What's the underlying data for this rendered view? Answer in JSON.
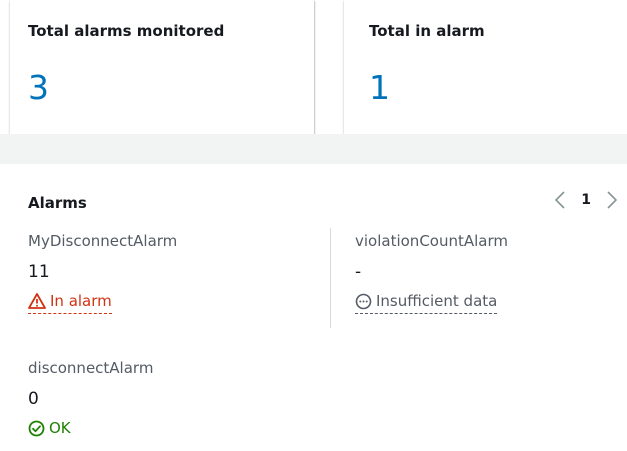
{
  "top_clip": "...",
  "summary": {
    "monitored_label": "Total alarms monitored",
    "monitored_value": "3",
    "inalarm_label": "Total in alarm",
    "inalarm_value": "1"
  },
  "alarms": {
    "title": "Alarms",
    "pagination": {
      "current_page": "1"
    },
    "items": [
      {
        "name": "MyDisconnectAlarm",
        "value": "11",
        "status": "In alarm",
        "status_icon": "warning-icon",
        "status_color": "#d13212"
      },
      {
        "name": "violationCountAlarm",
        "value": "-",
        "status": "Insufficient data",
        "status_icon": "ellipsis-circle-icon",
        "status_color": "#545b64"
      },
      {
        "name": "disconnectAlarm",
        "value": "0",
        "status": "OK",
        "status_icon": "check-circle-icon",
        "status_color": "#1d8102"
      }
    ]
  }
}
